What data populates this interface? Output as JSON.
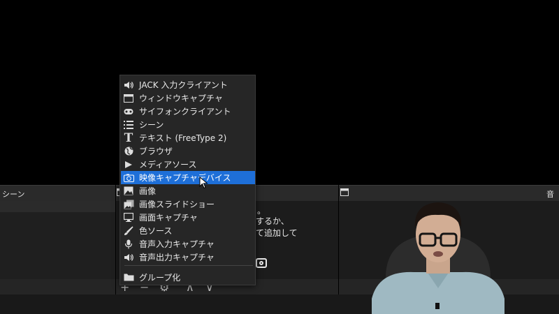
{
  "docks": {
    "scenes_title": "シーン",
    "audio_title": "音声"
  },
  "sources_hint": {
    "line1": "。",
    "line2": "するか、",
    "line3": "て追加して"
  },
  "menu": {
    "items": [
      {
        "label": "JACK 入力クライアント",
        "icon": "speaker-icon"
      },
      {
        "label": "ウィンドウキャプチャ",
        "icon": "window-icon"
      },
      {
        "label": "サイフォンクライアント",
        "icon": "gamepad-icon"
      },
      {
        "label": "シーン",
        "icon": "list-icon"
      },
      {
        "label": "テキスト (FreeType 2)",
        "icon": "text-icon"
      },
      {
        "label": "ブラウザ",
        "icon": "globe-icon"
      },
      {
        "label": "メディアソース",
        "icon": "play-icon"
      },
      {
        "label": "映像キャプチャデバイス",
        "icon": "camera-icon",
        "selected": true
      },
      {
        "label": "画像",
        "icon": "image-icon"
      },
      {
        "label": "画像スライドショー",
        "icon": "slideshow-icon"
      },
      {
        "label": "画面キャプチャ",
        "icon": "monitor-icon"
      },
      {
        "label": "色ソース",
        "icon": "brush-icon"
      },
      {
        "label": "音声入力キャプチャ",
        "icon": "microphone-icon"
      },
      {
        "label": "音声出力キャプチャ",
        "icon": "speaker-icon"
      }
    ],
    "group_label": "グループ化",
    "group_icon": "folder-icon"
  },
  "colors": {
    "selected_bg": "#1e6fd8",
    "menu_bg": "#262626",
    "panel_bg": "#1c1c1c"
  }
}
